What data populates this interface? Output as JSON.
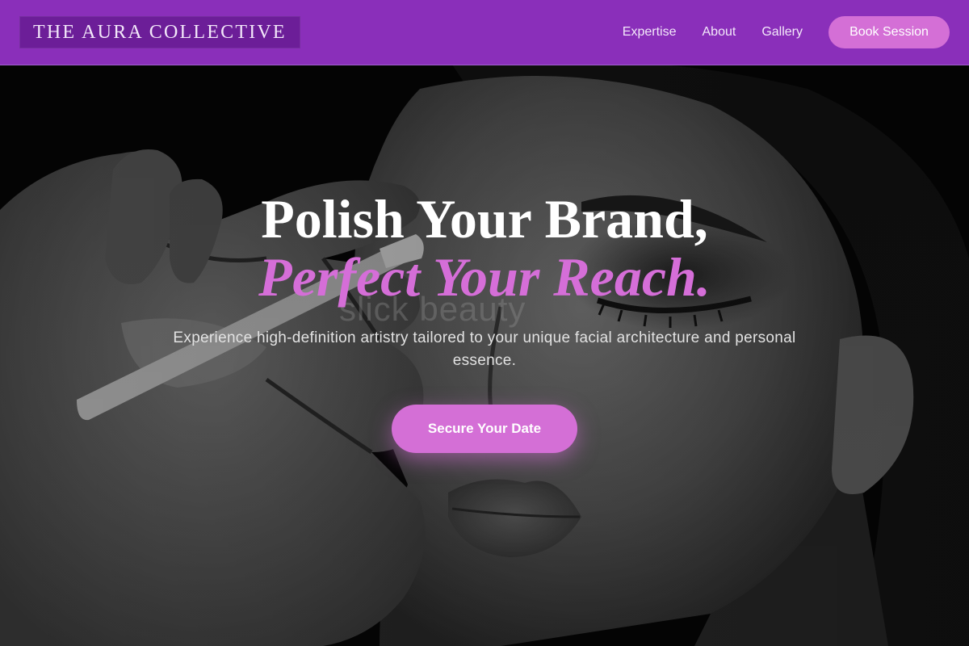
{
  "header": {
    "logo": "THE AURA COLLECTIVE",
    "nav": [
      {
        "label": "Expertise"
      },
      {
        "label": "About"
      },
      {
        "label": "Gallery"
      }
    ],
    "cta_label": "Book Session"
  },
  "hero": {
    "headline_line1": "Polish Your Brand,",
    "headline_line2": "Perfect Your Reach.",
    "subtitle": "Experience high-definition artistry tailored to your unique facial architecture and personal essence.",
    "cta_label": "Secure Your Date",
    "watermark": "slick beauty",
    "image": "grayscale-photo-makeup-artist-applying-eyeliner"
  },
  "colors": {
    "header_bg": "#8a2fba",
    "accent": "#d46fd6",
    "headline_accent": "#d56ed8",
    "text_light": "#f3e8fa"
  }
}
